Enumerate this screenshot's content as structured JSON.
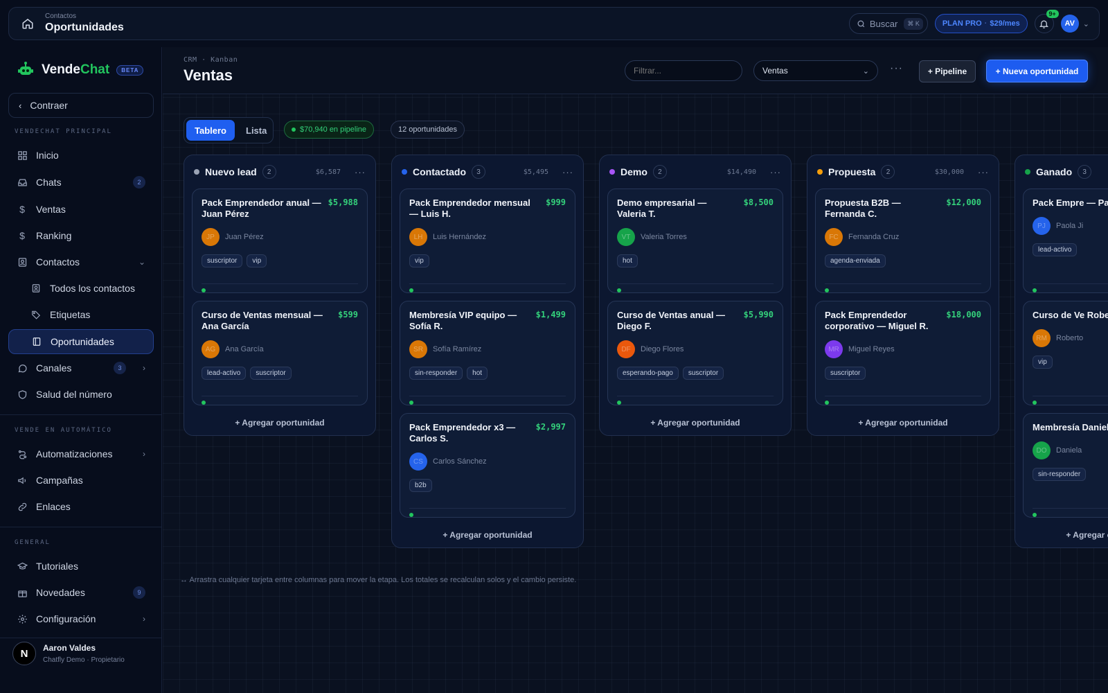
{
  "topbar": {
    "crumb_small": "Contactos",
    "crumb_big": "Oportunidades",
    "search_label": "Buscar",
    "search_kbd": "⌘ K",
    "plan_label": "PLAN PRO",
    "plan_price": "$29/mes",
    "notif_badge": "9+",
    "avatar_initials": "AV"
  },
  "sidebar": {
    "brand_prefix": "Vende",
    "brand_suffix": "Chat",
    "beta": "BETA",
    "collapse_label": "Contraer",
    "section1": "VENDECHAT PRINCIPAL",
    "items": [
      {
        "label": "Inicio",
        "icon": "grid-icon"
      },
      {
        "label": "Chats",
        "icon": "inbox-icon",
        "count": "2"
      },
      {
        "label": "Ventas",
        "icon": "dollar-icon"
      },
      {
        "label": "Ranking",
        "icon": "dollar-icon"
      },
      {
        "label": "Contactos",
        "icon": "contact-card-icon"
      },
      {
        "label": "Todos los contactos",
        "icon": "contact-card-icon"
      },
      {
        "label": "Etiquetas",
        "icon": "tag-icon"
      },
      {
        "label": "Oportunidades",
        "icon": "board-icon"
      },
      {
        "label": "Canales",
        "icon": "whatsapp-icon",
        "count": "3"
      },
      {
        "label": "Salud del número",
        "icon": "shield-icon"
      }
    ],
    "section2": "VENDE EN AUTOMÁTICO",
    "auto_items": [
      {
        "label": "Automatizaciones",
        "icon": "flow-icon"
      },
      {
        "label": "Campañas",
        "icon": "megaphone-icon"
      },
      {
        "label": "Enlaces",
        "icon": "link-icon"
      }
    ],
    "section3": "GENERAL",
    "general_items": [
      {
        "label": "Tutoriales",
        "icon": "graduation-icon"
      },
      {
        "label": "Novedades",
        "icon": "gift-icon",
        "count": "9"
      },
      {
        "label": "Configuración",
        "icon": "gear-icon"
      }
    ],
    "user": {
      "initial": "N",
      "name": "Aaron Valdes",
      "role": "Chatfly Demo · Propietario"
    }
  },
  "header": {
    "crumb": "CRM · Kanban",
    "title": "Ventas",
    "filter_placeholder": "Filtrar...",
    "pipeline_select": "Ventas",
    "pipeline_button": "+ Pipeline",
    "new_button": "+ Nueva oportunidad"
  },
  "toolbar": {
    "tab_board": "Tablero",
    "tab_list": "Lista",
    "pipeline_total": "$70,940 en pipeline",
    "opportunities_count": "12 oportunidades"
  },
  "add_label": "+ Agregar oportunidad",
  "add_label_cut": "+ Agr",
  "columns": [
    {
      "name": "Nuevo lead",
      "color": "#9aa3b5",
      "count": "2",
      "total": "$6,587",
      "cards": [
        {
          "title": "Pack Emprendedor anual — Juan Pérez",
          "amount": "$5,988",
          "initials": "JP",
          "color": "#d97706",
          "owner": "Juan Pérez",
          "tags": [
            "suscriptor",
            "vip"
          ]
        },
        {
          "title": "Curso de Ventas mensual — Ana García",
          "amount": "$599",
          "initials": "AG",
          "color": "#d97706",
          "owner": "Ana García",
          "tags": [
            "lead-activo",
            "suscriptor"
          ]
        }
      ]
    },
    {
      "name": "Contactado",
      "color": "#2563eb",
      "count": "3",
      "total": "$5,495",
      "cards": [
        {
          "title": "Pack Emprendedor mensual — Luis H.",
          "amount": "$999",
          "initials": "LH",
          "color": "#d97706",
          "owner": "Luis Hernández",
          "tags": [
            "vip"
          ]
        },
        {
          "title": "Membresía VIP equipo — Sofía R.",
          "amount": "$1,499",
          "initials": "SR",
          "color": "#d97706",
          "owner": "Sofía Ramírez",
          "tags": [
            "sin-responder",
            "hot"
          ]
        },
        {
          "title": "Pack Emprendedor x3 — Carlos S.",
          "amount": "$2,997",
          "initials": "CS",
          "color": "#2563eb",
          "owner": "Carlos Sánchez",
          "tags": [
            "b2b"
          ]
        }
      ]
    },
    {
      "name": "Demo",
      "color": "#a855f7",
      "count": "2",
      "total": "$14,490",
      "cards": [
        {
          "title": "Demo empresarial — Valeria T.",
          "amount": "$8,500",
          "initials": "VT",
          "color": "#16a34a",
          "owner": "Valeria Torres",
          "tags": [
            "hot"
          ]
        },
        {
          "title": "Curso de Ventas anual — Diego F.",
          "amount": "$5,990",
          "initials": "DF",
          "color": "#ea580c",
          "owner": "Diego Flores",
          "tags": [
            "esperando-pago",
            "suscriptor"
          ]
        }
      ]
    },
    {
      "name": "Propuesta",
      "color": "#f59e0b",
      "count": "2",
      "total": "$30,000",
      "cards": [
        {
          "title": "Propuesta B2B — Fernanda C.",
          "amount": "$12,000",
          "initials": "FC",
          "color": "#d97706",
          "owner": "Fernanda Cruz",
          "tags": [
            "agenda-enviada"
          ]
        },
        {
          "title": "Pack Emprendedor corporativo — Miguel R.",
          "amount": "$18,000",
          "initials": "MR",
          "color": "#7c3aed",
          "owner": "Miguel Reyes",
          "tags": [
            "suscriptor"
          ]
        }
      ]
    },
    {
      "name": "Ganado",
      "color": "#16a34a",
      "count": "3",
      "cards": [
        {
          "title": "Pack Empre — Paola J.",
          "initials": "PJ",
          "color": "#2563eb",
          "owner": "Paola Ji",
          "tags": [
            "lead-activo"
          ]
        },
        {
          "title": "Curso de Ve Roberto M.",
          "initials": "RM",
          "color": "#d97706",
          "owner": "Roberto",
          "tags": [
            "vip"
          ]
        },
        {
          "title": "Membresía Daniela O.",
          "initials": "DO",
          "color": "#16a34a",
          "owner": "Daniela",
          "tags": [
            "sin-responder"
          ]
        }
      ]
    }
  ],
  "hint": "↔ Arrastra cualquier tarjeta entre columnas para mover la etapa. Los totales se recalculan solos y el cambio persiste."
}
